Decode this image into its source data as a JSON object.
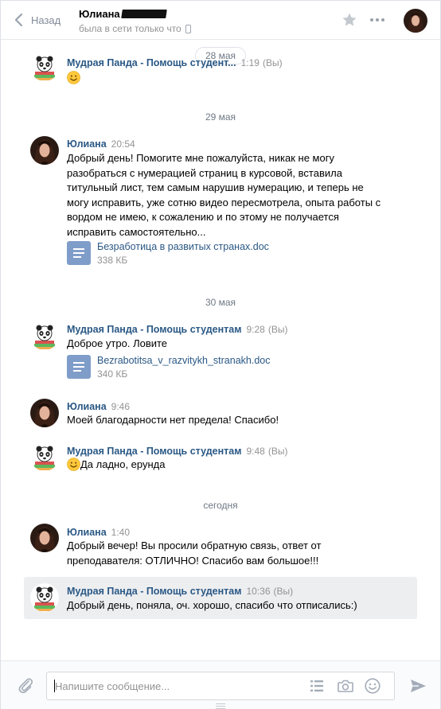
{
  "header": {
    "back_label": "Назад",
    "peer_name": "Юлиана",
    "peer_status": "была в сети только что",
    "icons": [
      "chevron-left-icon",
      "star-icon",
      "more-dots-icon",
      "phone-icon"
    ]
  },
  "colors": {
    "link": "#2a5885",
    "meta": "#939393",
    "doc_icon": "#7f9dc9",
    "highlight": "#edeef0"
  },
  "dates": {
    "d1": "28 мая",
    "d2": "29 мая",
    "d3": "30 мая",
    "d4": "сегодня"
  },
  "messages": [
    {
      "author": "Мудрая Панда - Помощь студентам",
      "author_truncated": "Мудрая Панда - Помощь студент...",
      "time": "1:19",
      "you_tag": "(Вы)",
      "text": ""
    },
    {
      "author": "Юлиана",
      "time": "20:54",
      "text": "Добрый день! Помогите мне пожалуйста, никак не могу разобраться с нумерацией страниц в курсовой, вставила титульный лист, тем самым нарушив нумерацию, и теперь не могу исправить, уже сотню видео пересмотрела, опыта работы с вордом не имею, к сожалению и по этому не получается исправить самостоятельно...",
      "attachment": {
        "name": "Безработица в развитых странах.doc",
        "size": "338 КБ"
      }
    },
    {
      "author": "Мудрая Панда - Помощь студентам",
      "time": "9:28",
      "you_tag": "(Вы)",
      "text": "Доброе утро. Ловите",
      "attachment": {
        "name": "Bezrabotitsa_v_razvitykh_stranakh.doc",
        "size": "340 КБ"
      }
    },
    {
      "author": "Юлиана",
      "time": "9:46",
      "text": "Моей благодарности нет предела! Спасибо!"
    },
    {
      "author": "Мудрая Панда - Помощь студентам",
      "time": "9:48",
      "you_tag": "(Вы)",
      "text": "Да ладно, ерунда"
    },
    {
      "author": "Юлиана",
      "time": "1:40",
      "text": "Добрый вечер! Вы просили обратную связь, ответ от преподавателя: ОТЛИЧНО! Спасибо вам большое!!!"
    },
    {
      "author": "Мудрая Панда - Помощь студентам",
      "time": "10:36",
      "you_tag": "(Вы)",
      "text": "Добрый день, поняла, оч. хорошо, спасибо что отписались:)"
    }
  ],
  "composer": {
    "placeholder": "Напишите сообщение...",
    "icons": [
      "paperclip-icon",
      "list-icon",
      "camera-icon",
      "smile-icon",
      "send-icon"
    ]
  }
}
